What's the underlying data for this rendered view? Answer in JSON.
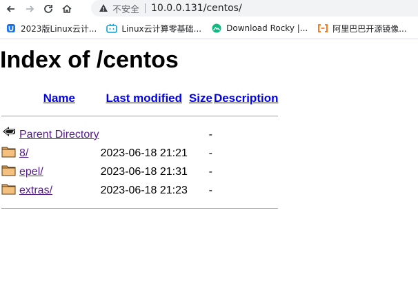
{
  "toolbar": {
    "security_label": "不安全",
    "url": "10.0.0.131/centos/"
  },
  "bookmarks": [
    {
      "label": "2023版Linux云计...",
      "icon": "bookmark-u-icon",
      "color": "#1a73e8"
    },
    {
      "label": "Linux云计算零基础...",
      "icon": "bilibili-icon",
      "color": "#00a1d6"
    },
    {
      "label": "Download Rocky |...",
      "icon": "rocky-icon",
      "color": "#10b981"
    },
    {
      "label": "阿里巴巴开源镜像...",
      "icon": "aliyun-icon",
      "color": "#ff6a00"
    }
  ],
  "page": {
    "title": "Index of /centos"
  },
  "listing": {
    "headers": {
      "name": "Name",
      "last_modified": "Last modified",
      "size": "Size",
      "description": "Description"
    },
    "rows": [
      {
        "icon": "back-icon",
        "name": "Parent Directory",
        "date": "",
        "size": "-"
      },
      {
        "icon": "folder-icon",
        "name": "8/",
        "date": "2023-06-18 21:21",
        "size": "-"
      },
      {
        "icon": "folder-icon",
        "name": "epel/",
        "date": "2023-06-18 21:31",
        "size": "-"
      },
      {
        "icon": "folder-icon",
        "name": "extras/",
        "date": "2023-06-18 21:23",
        "size": "-"
      }
    ]
  }
}
